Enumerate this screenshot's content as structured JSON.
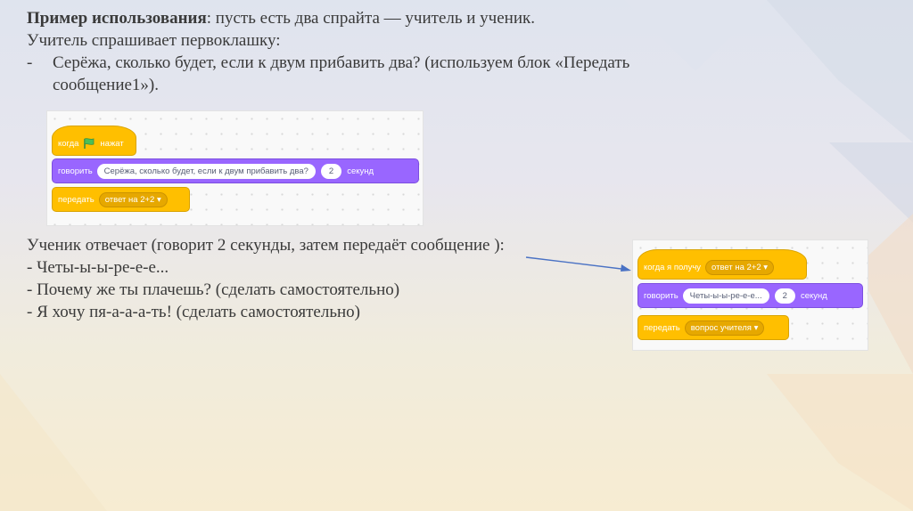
{
  "slide": {
    "intro_bold": "Пример использования",
    "intro_rest": ": пусть есть два спрайта — учитель и ученик.",
    "teacher_asks": "Учитель спрашивает первоклашку:",
    "dash": "-",
    "teacher_item_line1": "Серёжа, сколько будет, если к двум прибавить два? (используем блок «Передать",
    "teacher_item_line2": "сообщение1»).",
    "student_answers": "Ученик отвечает (говорит 2 секунды, затем передаёт сообщение ):",
    "student_items": [
      "- Четы-ы-ы-ре-е-е...",
      "- Почему же ты плачешь? (сделать самостоятельно)",
      "- Я хочу пя-а-а-а-ть! (сделать самостоятельно)"
    ]
  },
  "script1": {
    "hat_when": "когда",
    "hat_clicked": "нажат",
    "say_label": "говорить",
    "say_text": "Серёжа, сколько будет, если к двум прибавить два?",
    "say_secs": "2",
    "say_unit": "секунд",
    "broadcast_label": "передать",
    "broadcast_msg": "ответ на 2+2"
  },
  "script2": {
    "hat_label": "когда я получу",
    "hat_msg": "ответ на 2+2",
    "say_label": "говорить",
    "say_text": "Четы-ы-ы-ре-е-е...",
    "say_secs": "2",
    "say_unit": "секунд",
    "broadcast_label": "передать",
    "broadcast_msg": "вопрос учителя"
  },
  "icons": {
    "flag": "green-flag-icon",
    "dropdown": "dropdown-arrow-icon",
    "arrow": "arrow-icon"
  },
  "colors": {
    "events": "#ffbf00",
    "looks": "#9966ff",
    "flag": "#4cbf56",
    "arrow": "#4a72c4"
  }
}
